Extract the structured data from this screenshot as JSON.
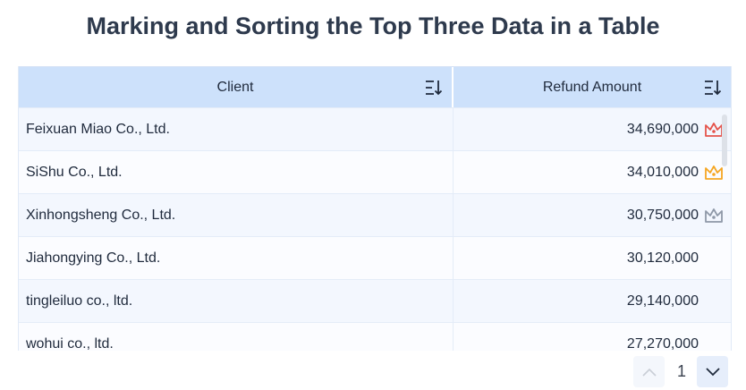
{
  "title": "Marking and Sorting the Top Three Data in a Table",
  "columns": [
    "Client",
    "Refund Amount"
  ],
  "rows": [
    {
      "client": "Feixuan Miao Co., Ltd.",
      "amount": "34,690,000",
      "crown": "#e5534b"
    },
    {
      "client": "SiShu Co., Ltd.",
      "amount": "34,010,000",
      "crown": "#f5a623"
    },
    {
      "client": "Xinhongsheng Co., Ltd.",
      "amount": "30,750,000",
      "crown": "#8f99a8"
    },
    {
      "client": "Jiahongying Co., Ltd.",
      "amount": "30,120,000",
      "crown": null
    },
    {
      "client": "tingleiluo co., ltd.",
      "amount": "29,140,000",
      "crown": null
    },
    {
      "client": "wohui co., ltd.",
      "amount": "27,270,000",
      "crown": null
    }
  ],
  "pagination": {
    "page": "1"
  }
}
